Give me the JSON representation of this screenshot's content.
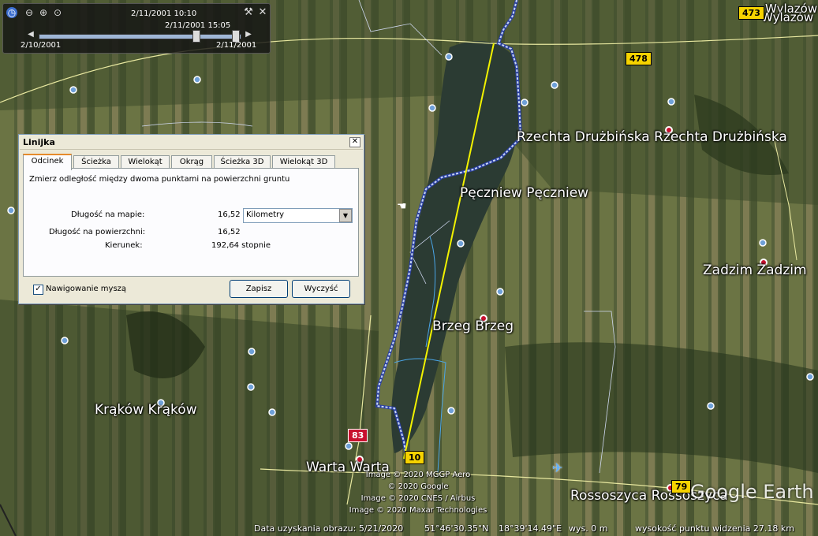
{
  "timeslider": {
    "current_time": "2/11/2001  10:10",
    "end_time": "2/11/2001  15:05",
    "range_start": "2/10/2001",
    "range_end": "2/11/2001"
  },
  "dialog": {
    "title": "Linijka",
    "tabs": [
      "Odcinek",
      "Ścieżka",
      "Wielokąt",
      "Okrąg",
      "Ścieżka 3D",
      "Wielokąt 3D"
    ],
    "active_tab": "Odcinek",
    "description": "Zmierz odległość między dwoma punktami na powierzchni gruntu",
    "map_length_label": "Długość na mapie:",
    "map_length_value": "16,52",
    "unit_selected": "Kilometry",
    "surface_length_label": "Długość na powierzchni:",
    "surface_length_value": "16,52",
    "heading_label": "Kierunek:",
    "heading_value": "192,64 stopnie",
    "mouse_nav_label": "Nawigowanie myszą",
    "mouse_nav_checked": true,
    "save_label": "Zapisz",
    "clear_label": "Wyczyść"
  },
  "places": {
    "rzechta": "Rzechta Drużbińska  Rzechta Drużbińska",
    "peczniew": "Pęczniew  Pęczniew",
    "zadzim": "Zadzim  Zadzim",
    "brzeg": "Brzeg  Brzeg",
    "krakow": "Krąków  Krąków",
    "warta": "Warta  Warta",
    "rossoszyca": "Rossoszyca  Rossoszyca",
    "wylazow": "Wylazów",
    "wylazow2": "Wylazów"
  },
  "roads": {
    "r473": "473",
    "r478": "478",
    "r83": "83",
    "r10": "10",
    "r79": "79"
  },
  "credits": [
    "Image © 2020 MGGP Aero",
    "© 2020 Google",
    "Image © 2020 CNES / Airbus",
    "Image © 2020 Maxar Technologies"
  ],
  "logo": "Google Earth",
  "status": {
    "capture_date": "Data uzyskania obrazu: 5/21/2020",
    "lat": "51°46'30.35\"N",
    "lon": "18°39'14.49\"E",
    "elev": "wys.    0 m",
    "eye_alt": "wysokość punktu widzenia  27.18 km"
  },
  "colors": {
    "ruler_line": "#f2f200",
    "track": "#c8d6f2",
    "dialog_bg": "#ece9d8",
    "active_tab_accent": "#e68b2c"
  }
}
